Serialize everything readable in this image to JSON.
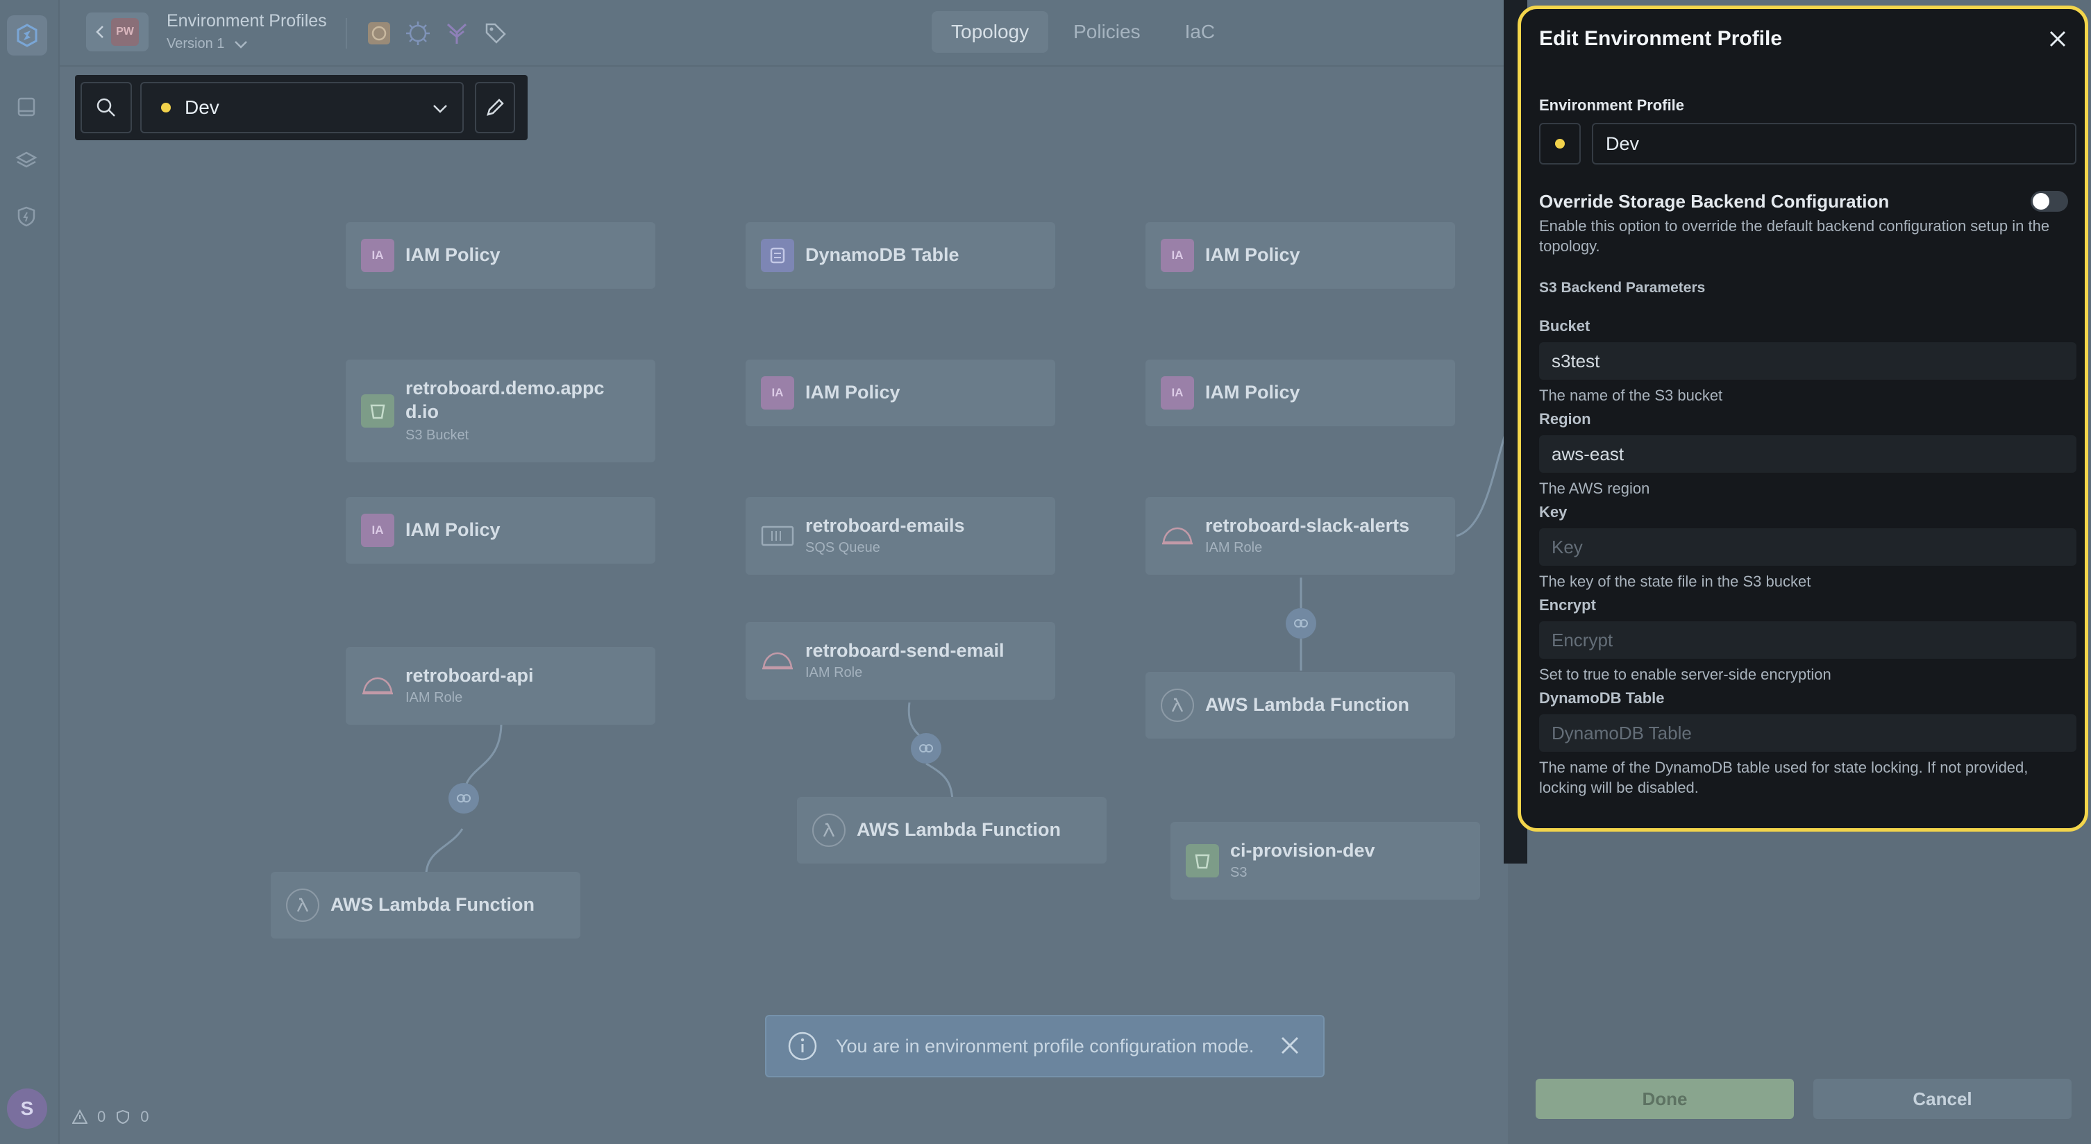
{
  "header": {
    "back_initials": "PW",
    "title": "Environment Profiles",
    "version": "Version 1",
    "tabs": [
      "Topology",
      "Policies",
      "IaC"
    ],
    "active_tab": "Topology"
  },
  "env_selector": {
    "selected": "Dev"
  },
  "nodes": [
    {
      "title": "IAM Policy",
      "icon_text": "IA"
    },
    {
      "title": "DynamoDB Table"
    },
    {
      "title": "IAM Policy",
      "icon_text": "IA"
    },
    {
      "title": "retroboard.demo.appc",
      "title2": "d.io",
      "subtitle": "S3 Bucket"
    },
    {
      "title": "IAM Policy",
      "icon_text": "IA"
    },
    {
      "title": "IAM Policy",
      "icon_text": "IA"
    },
    {
      "title": "IAM Policy",
      "icon_text": "IA"
    },
    {
      "title": "retroboard-emails",
      "subtitle": "SQS Queue"
    },
    {
      "title": "retroboard-slack-alerts",
      "subtitle": "IAM Role"
    },
    {
      "title": "retroboard-api",
      "subtitle": "IAM Role"
    },
    {
      "title": "retroboard-send-email",
      "subtitle": "IAM Role"
    },
    {
      "title": "AWS Lambda Function"
    },
    {
      "title": "AWS Lambda Function"
    },
    {
      "title": "AWS Lambda Function"
    },
    {
      "title": "ci-provision-dev",
      "subtitle": "S3"
    }
  ],
  "banner": {
    "text": "You are in environment profile configuration mode."
  },
  "status": {
    "warnings": "0",
    "errors": "0"
  },
  "user": {
    "avatar_initial": "S"
  },
  "panel": {
    "title": "Edit Environment Profile",
    "env_profile_label": "Environment Profile",
    "env_profile_value": "Dev",
    "override_label": "Override Storage Backend Configuration",
    "override_help": "Enable this option to override the default backend configuration setup in the topology.",
    "override_enabled": false,
    "section_label": "S3 Backend Parameters",
    "fields": [
      {
        "label": "Bucket",
        "value": "s3test",
        "placeholder": "",
        "help": "The name of the S3 bucket"
      },
      {
        "label": "Region",
        "value": "aws-east",
        "placeholder": "",
        "help": "The AWS region"
      },
      {
        "label": "Key",
        "value": "",
        "placeholder": "Key",
        "help": "The key of the state file in the S3 bucket"
      },
      {
        "label": "Encrypt",
        "value": "",
        "placeholder": "Encrypt",
        "help": "Set to true to enable server-side encryption"
      },
      {
        "label": "DynamoDB Table",
        "value": "",
        "placeholder": "DynamoDB Table",
        "help": "The name of the DynamoDB table used for state locking. If not provided, locking will be disabled."
      }
    ],
    "done_label": "Done",
    "cancel_label": "Cancel"
  },
  "colors": {
    "accent_yellow": "#f3d54b",
    "panel_bg": "#15181c",
    "canvas_bg": "#627381"
  }
}
